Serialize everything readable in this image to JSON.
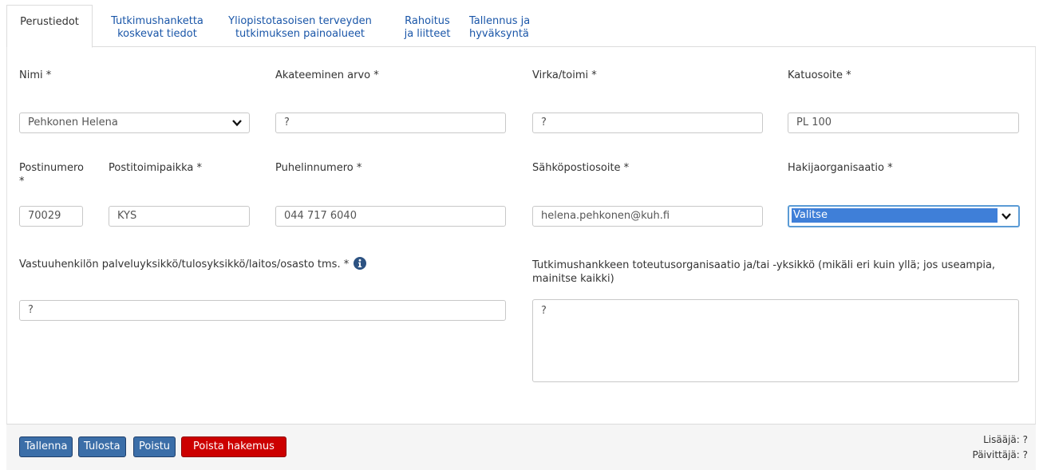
{
  "tabs": [
    {
      "line1": "Perustiedot",
      "line2": ""
    },
    {
      "line1": "Tutkimushanketta",
      "line2": "koskevat tiedot"
    },
    {
      "line1": "Yliopistotasoisen terveyden",
      "line2": "tutkimuksen painoalueet"
    },
    {
      "line1": "Rahoitus",
      "line2": "ja liitteet"
    },
    {
      "line1": "Tallennus ja",
      "line2": "hyväksyntä"
    }
  ],
  "form": {
    "nimi": {
      "label": "Nimi *",
      "value": "Pehkonen Helena"
    },
    "arvo": {
      "label": "Akateeminen arvo *",
      "value": "?"
    },
    "virka": {
      "label": "Virka/toimi *",
      "value": "?"
    },
    "katuosoite": {
      "label": "Katuosoite *",
      "value": "PL 100"
    },
    "postinumero": {
      "label_line1": "Postinumero",
      "label_line2": "*",
      "value": "70029"
    },
    "postitoimipaikka": {
      "label": "Postitoimipaikka *",
      "value": "KYS"
    },
    "puhelin": {
      "label": "Puhelinnumero *",
      "value": "044 717 6040"
    },
    "sahkoposti": {
      "label": "Sähköpostiosoite *",
      "value": "helena.pehkonen@kuh.fi"
    },
    "hakijaorganisaatio": {
      "label": "Hakijaorganisaatio *",
      "value": "Valitse"
    },
    "vastuuyksikko": {
      "label": "Vastuuhenkilön palveluyksikkö/tulosyksikkö/laitos/osasto tms. *",
      "value": "?"
    },
    "toteutusorganisaatio": {
      "label_line1": "Tutkimushankkeen toteutusorganisaatio ja/tai -yksikkö (mikäli eri kuin yllä; jos useampia,",
      "label_line2": "mainitse kaikki)",
      "value": "?"
    }
  },
  "footer": {
    "save": "Tallenna",
    "print": "Tulosta",
    "exit": "Poistu",
    "delete": "Poista hakemus",
    "added_by": "Lisääjä: ?",
    "updated_by": "Päivittäjä: ?"
  },
  "colors": {
    "link": "#1a56a8",
    "primary_button": "#3b6ea8",
    "danger_button": "#cc0000",
    "focus": "#5b9bd5"
  },
  "icons": {
    "dropdown": "chevron-down-icon",
    "info": "info-icon"
  }
}
